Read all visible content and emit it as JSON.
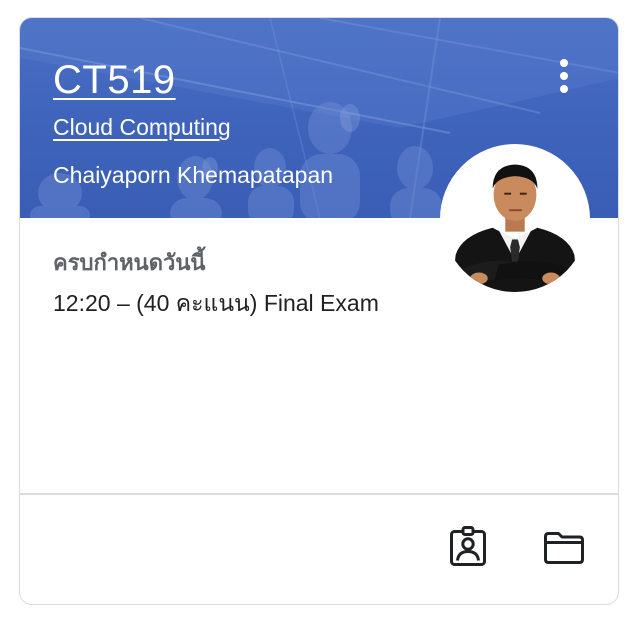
{
  "card": {
    "course_code": "CT519",
    "course_name": "Cloud Computing",
    "teacher": "Chaiyaporn Khemapatapan",
    "banner_color": "#3e63bb"
  },
  "due": {
    "heading": "ครบกำหนดวันนี้",
    "items": [
      {
        "text": "12:20 – (40 คะแนน) Final Exam"
      }
    ]
  },
  "icons": {
    "more": "more-vert-icon",
    "work": "assignment-ind-icon",
    "folder": "folder-icon"
  }
}
